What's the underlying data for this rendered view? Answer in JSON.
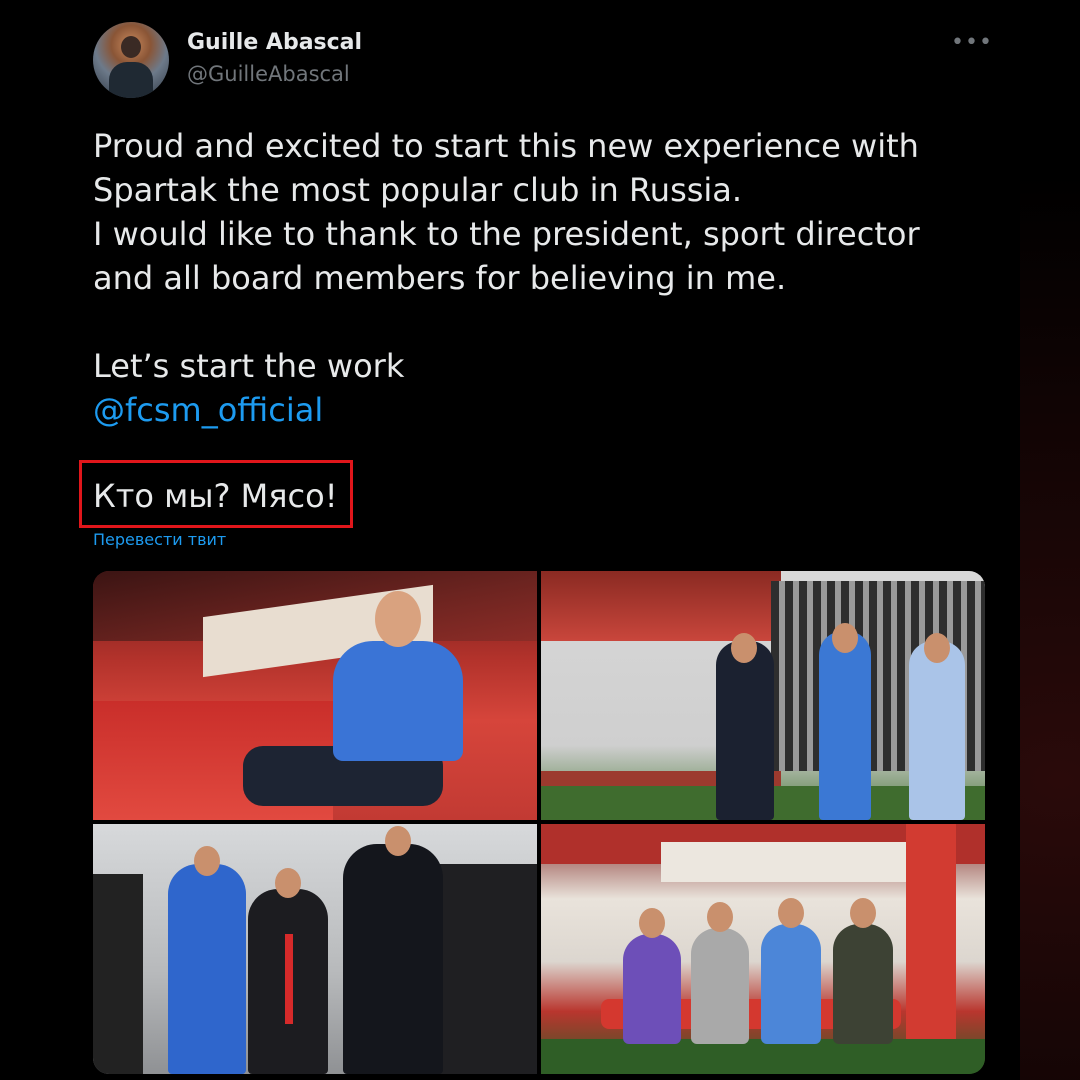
{
  "author": {
    "name": "Guille Abascal",
    "handle": "@GuilleAbascal"
  },
  "menu_icon": "more-horizontal-icon",
  "menu_glyph": "•••",
  "tweet": {
    "paragraph1": "Proud and excited to start this new experience with\nSpartak the most popular club in Russia.\nI would like to thank to the president, sport director\nand all board members for believing in me.",
    "paragraph2": "Let’s start the work",
    "mention": "@fcsm_official",
    "russian_line": "Кто мы? Мясо!",
    "translate_link": "Перевести твит"
  },
  "colors": {
    "background": "#000000",
    "text": "#e7e9ea",
    "muted": "#71767b",
    "link": "#1d9bf0",
    "highlight_box": "#e0161b"
  },
  "media": {
    "count": 4,
    "photos": [
      "dugout-photo",
      "pitch-walk-photo",
      "locker-room-photo",
      "bench-group-photo"
    ]
  }
}
